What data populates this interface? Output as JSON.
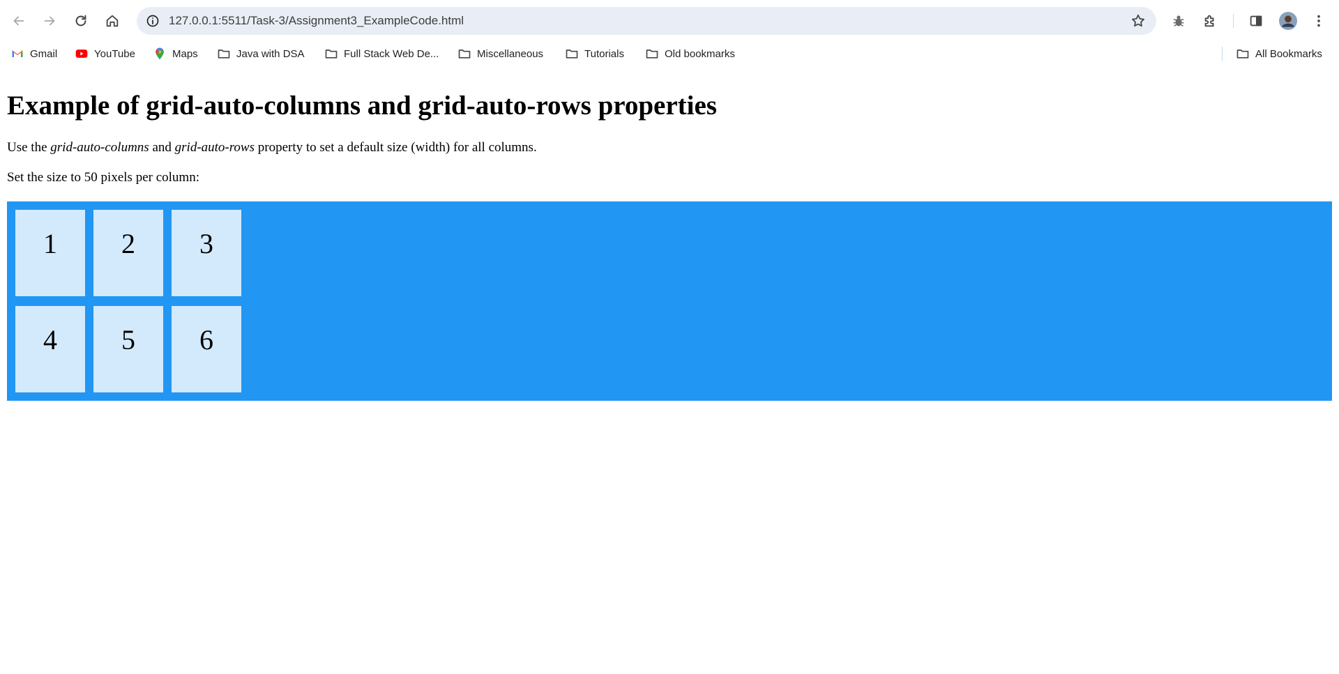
{
  "browser": {
    "url": "127.0.0.1:5511/Task-3/Assignment3_ExampleCode.html",
    "icons": [
      "back-icon",
      "forward-icon",
      "reload-icon",
      "home-icon",
      "site-info-icon",
      "star-icon",
      "bug-extension-icon",
      "extensions-icon",
      "side-panel-icon",
      "avatar",
      "more-icon"
    ]
  },
  "bookmarks": {
    "items": [
      {
        "label": "Gmail",
        "icon": "gmail-icon"
      },
      {
        "label": "YouTube",
        "icon": "youtube-icon"
      },
      {
        "label": "Maps",
        "icon": "maps-icon"
      },
      {
        "label": "Java with DSA",
        "icon": "folder-icon"
      },
      {
        "label": "Full Stack Web De...",
        "icon": "folder-icon"
      },
      {
        "label": "Miscellaneous",
        "icon": "folder-icon"
      },
      {
        "label": "Tutorials",
        "icon": "folder-icon"
      },
      {
        "label": "Old bookmarks",
        "icon": "folder-icon"
      }
    ],
    "all_bookmarks": "All Bookmarks"
  },
  "page": {
    "title": "Example of grid-auto-columns and grid-auto-rows properties",
    "intro_prefix": "Use the ",
    "intro_term1": "grid-auto-columns",
    "intro_mid": " and ",
    "intro_term2": "grid-auto-rows",
    "intro_suffix": " property to set a default size (width) for all columns.",
    "size_note": "Set the size to 50 pixels per column:",
    "grid_items": [
      "1",
      "2",
      "3",
      "4",
      "5",
      "6"
    ],
    "colors": {
      "container": "#2196f3",
      "item": "#d3eafd"
    }
  }
}
